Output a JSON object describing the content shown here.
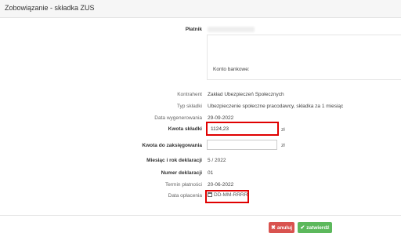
{
  "header": {
    "title": "Zobowiązanie - składka ZUS"
  },
  "payer": {
    "label": "Płatnik",
    "account_label": "Konto bankowe:"
  },
  "details": {
    "contractor_label": "Kontrahent",
    "contractor_value": "Zakład Ubezpieczeń Społecznych",
    "type_label": "Typ składki",
    "type_value": "Ubezpieczenie społeczne pracodawcy, składka za 1 miesiąc",
    "generated_label": "Data wygenerowania",
    "generated_value": "29-09-2022",
    "amount_label": "Kwota składki",
    "amount_value": "1124,23",
    "amount_unit": "zł",
    "post_label": "Kwota do zaksięgowania",
    "post_value": "",
    "post_unit": "zł",
    "period_label": "Miesiąc i rok deklaracji",
    "period_value": "5 / 2022",
    "decl_no_label": "Numer deklaracji",
    "decl_no_value": "01",
    "due_label": "Termin płatności",
    "due_value": "20-06-2022",
    "paid_label": "Data opłacenia",
    "paid_placeholder": "DD-MM-RRRR"
  },
  "buttons": {
    "cancel": "anuluj",
    "approve": "zatwierdź"
  },
  "colors": {
    "cancel": "#d9534f",
    "approve": "#5cb85c",
    "highlight": "#e00000"
  }
}
